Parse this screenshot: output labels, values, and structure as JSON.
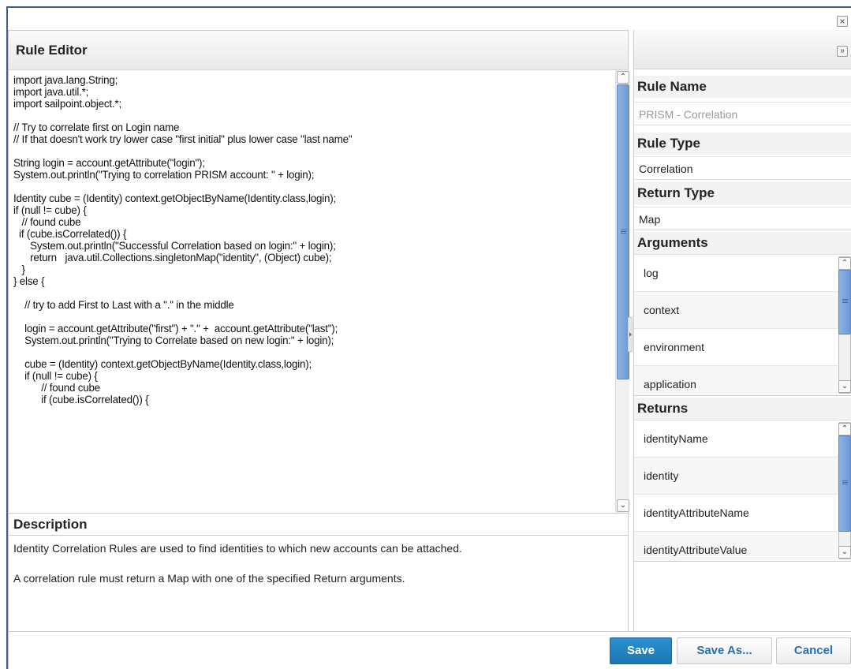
{
  "dialog": {
    "close_icon": "×",
    "expand_icon": "»"
  },
  "editor": {
    "title": "Rule Editor",
    "code": "import java.lang.String;\nimport java.util.*;\nimport sailpoint.object.*;\n\n// Try to correlate first on Login name\n// If that doesn't work try lower case \"first initial\" plus lower case \"last name\"\n\nString login = account.getAttribute(\"login\");\nSystem.out.println(\"Trying to correlation PRISM account: \" + login);\n\nIdentity cube = (Identity) context.getObjectByName(Identity.class,login);\nif (null != cube) {\n   // found cube\n  if (cube.isCorrelated()) {\n      System.out.println(\"Successful Correlation based on login:\" + login);\n      return   java.util.Collections.singletonMap(\"identity\", (Object) cube);\n   }\n} else {\n\n    // try to add First to Last with a \".\" in the middle\n\n    login = account.getAttribute(\"first\") + \".\" +  account.getAttribute(\"last\");\n    System.out.println(\"Trying to Correlate based on new login:\" + login);\n\n    cube = (Identity) context.getObjectByName(Identity.class,login);\n    if (null != cube) {\n          // found cube\n          if (cube.isCorrelated()) {"
  },
  "description": {
    "title": "Description",
    "line1": "Identity Correlation Rules are used to find identities to which new accounts can be attached.",
    "line2": "A correlation rule must return a Map with one of the specified Return arguments."
  },
  "properties": {
    "rule_name_label": "Rule Name",
    "rule_name_value": "PRISM - Correlation",
    "rule_type_label": "Rule Type",
    "rule_type_value": "Correlation",
    "return_type_label": "Return Type",
    "return_type_value": "Map",
    "arguments_label": "Arguments",
    "arguments": [
      "log",
      "context",
      "environment",
      "application"
    ],
    "returns_label": "Returns",
    "returns": [
      "identityName",
      "identity",
      "identityAttributeName",
      "identityAttributeValue"
    ]
  },
  "footer": {
    "save": "Save",
    "save_as": "Save As...",
    "cancel": "Cancel"
  },
  "colors": {
    "primary": "#1f84c2",
    "border": "#3a5f8f",
    "scroll_thumb": "#7aa6dd"
  }
}
